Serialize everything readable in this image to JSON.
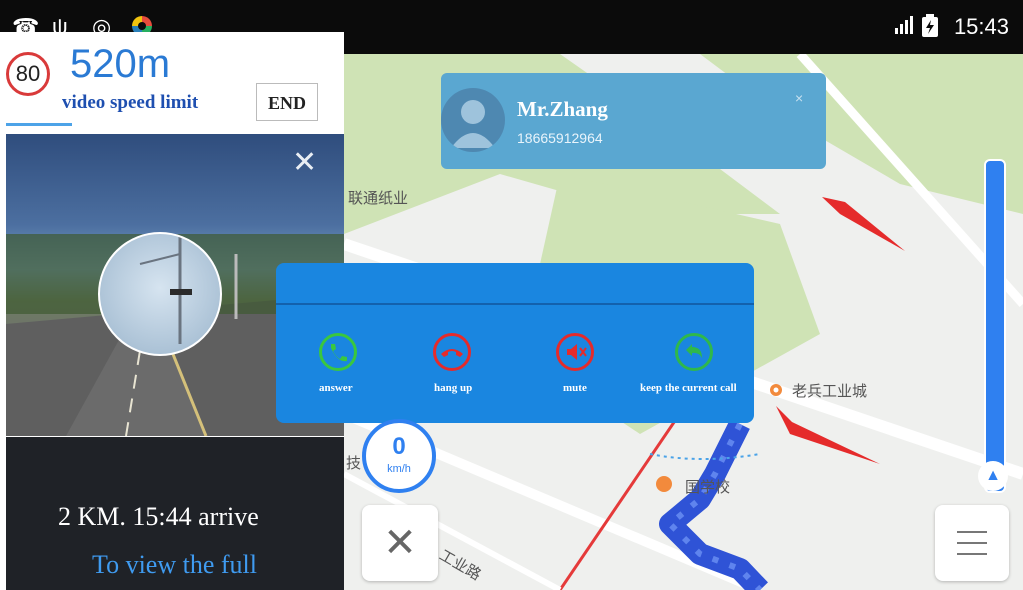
{
  "status_bar": {
    "time": "15:43",
    "icons": [
      "phone-icon",
      "usb-icon",
      "gps-icon",
      "app-icon",
      "signal-icon",
      "battery-icon"
    ]
  },
  "navigation": {
    "speed_limit": "80",
    "distance": "520m",
    "speed_caption": "video speed limit",
    "end_label": "END",
    "arrive_text": "2 KM.  15:44 arrive",
    "view_full": "To view the full"
  },
  "caller": {
    "name": "Mr.Zhang",
    "number": "18665912964",
    "close": "×"
  },
  "call_actions": [
    {
      "label": "answer",
      "color": "#3ac73f"
    },
    {
      "label": "hang up",
      "color": "#e52b2b"
    },
    {
      "label": "mute",
      "color": "#e52b2b"
    },
    {
      "label": "keep the current call",
      "color": "#2fb84b"
    }
  ],
  "map": {
    "labels": [
      "联通纸业",
      "老兵工业城",
      "国学校",
      "工业路",
      "技"
    ]
  },
  "speedometer": {
    "value": "0",
    "unit": "km/h"
  },
  "colors": {
    "accent": "#1a86e0",
    "route": "#2f53d6",
    "alert_arrow": "#e52b2b"
  }
}
